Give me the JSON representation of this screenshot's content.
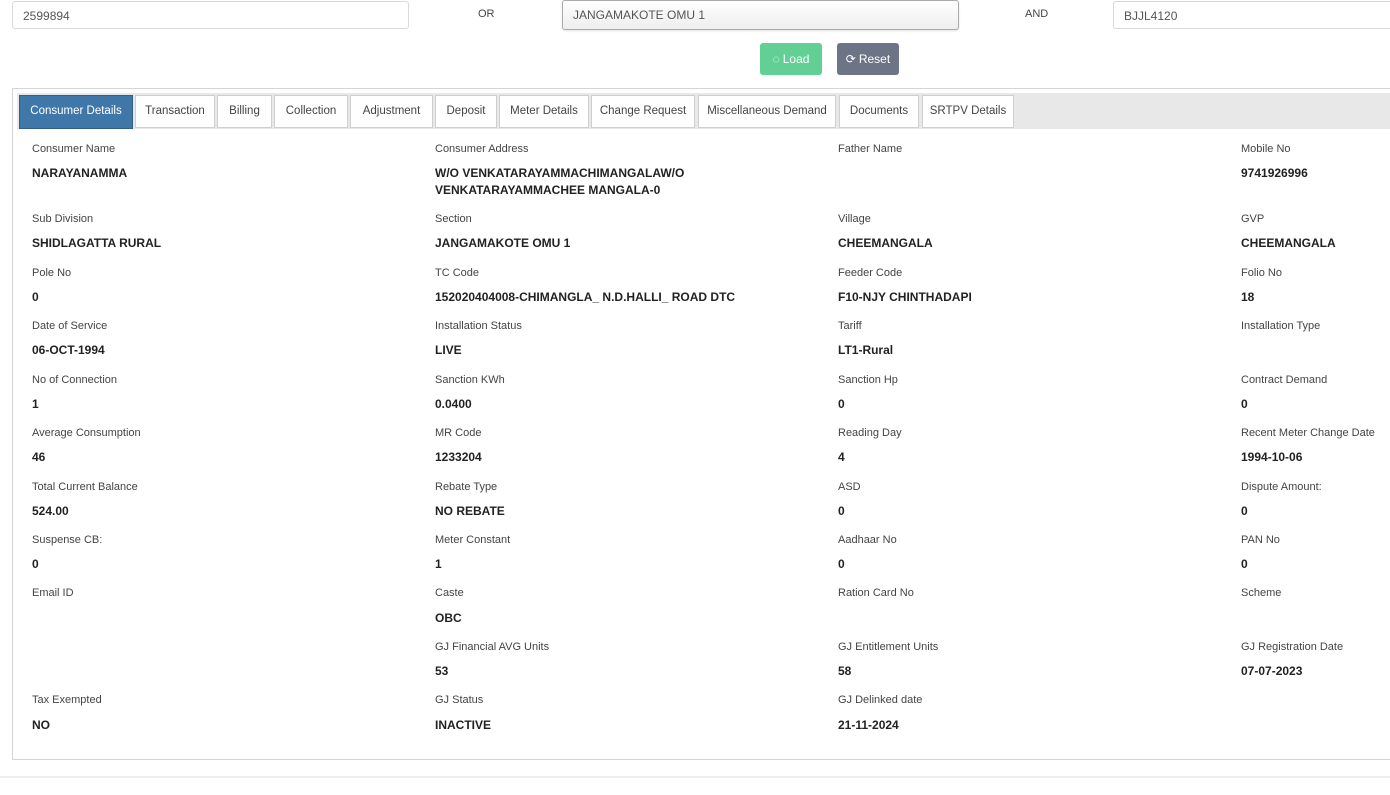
{
  "search": {
    "account_value": "2599894",
    "or_label": "OR",
    "section_value": "JANGAMAKOTE OMU 1",
    "and_label": "AND",
    "rr_value": "BJJL4120"
  },
  "buttons": {
    "load_label": "Load",
    "reset_label": "Reset"
  },
  "tabs": [
    {
      "label": "Consumer Details",
      "active": true
    },
    {
      "label": "Transaction"
    },
    {
      "label": "Billing"
    },
    {
      "label": "Collection"
    },
    {
      "label": "Adjustment"
    },
    {
      "label": "Deposit"
    },
    {
      "label": "Meter Details"
    },
    {
      "label": "Change Request"
    },
    {
      "label": "Miscellaneous Demand"
    },
    {
      "label": "Documents"
    },
    {
      "label": "SRTPV Details"
    }
  ],
  "fields": {
    "consumer_name": {
      "label": "Consumer Name",
      "value": "NARAYANAMMA"
    },
    "consumer_address": {
      "label": "Consumer Address",
      "value": "W/O VENKATARAYAMMACHIMANGALAW/O VENKATARAYAMMACHEE MANGALA-0"
    },
    "father_name": {
      "label": "Father Name",
      "value": ""
    },
    "mobile_no": {
      "label": "Mobile No",
      "value": "9741926996"
    },
    "sub_division": {
      "label": "Sub Division",
      "value": "SHIDLAGATTA RURAL"
    },
    "section": {
      "label": "Section",
      "value": "JANGAMAKOTE OMU 1"
    },
    "village": {
      "label": "Village",
      "value": "CHEEMANGALA"
    },
    "gvp": {
      "label": "GVP",
      "value": "CHEEMANGALA"
    },
    "pole_no": {
      "label": "Pole No",
      "value": "0"
    },
    "tc_code": {
      "label": "TC Code",
      "value": "152020404008-CHIMANGLA_ N.D.HALLI_ ROAD DTC"
    },
    "feeder_code": {
      "label": "Feeder Code",
      "value": "F10-NJY CHINTHADAPI"
    },
    "folio_no": {
      "label": "Folio No",
      "value": "18"
    },
    "date_of_service": {
      "label": "Date of Service",
      "value": "06-OCT-1994"
    },
    "installation_status": {
      "label": "Installation Status",
      "value": "LIVE"
    },
    "tariff": {
      "label": "Tariff",
      "value": "LT1-Rural"
    },
    "installation_type": {
      "label": "Installation Type",
      "value": ""
    },
    "no_of_connection": {
      "label": "No of Connection",
      "value": "1"
    },
    "sanction_kwh": {
      "label": "Sanction KWh",
      "value": "0.0400"
    },
    "sanction_hp": {
      "label": "Sanction Hp",
      "value": "0"
    },
    "contract_demand": {
      "label": "Contract Demand",
      "value": "0"
    },
    "average_consumption": {
      "label": "Average Consumption",
      "value": "46"
    },
    "mr_code": {
      "label": "MR Code",
      "value": "1233204"
    },
    "reading_day": {
      "label": "Reading Day",
      "value": "4"
    },
    "recent_meter_change_date": {
      "label": "Recent Meter Change Date",
      "value": "1994-10-06"
    },
    "total_current_balance": {
      "label": "Total Current Balance",
      "value": "524.00"
    },
    "rebate_type": {
      "label": "Rebate Type",
      "value": "NO REBATE"
    },
    "asd": {
      "label": "ASD",
      "value": "0"
    },
    "dispute_amount": {
      "label": "Dispute Amount:",
      "value": "0"
    },
    "suspense_cb": {
      "label": "Suspense CB:",
      "value": "0"
    },
    "meter_constant": {
      "label": "Meter Constant",
      "value": "1"
    },
    "aadhaar_no": {
      "label": "Aadhaar No",
      "value": "0"
    },
    "pan_no": {
      "label": "PAN No",
      "value": "0"
    },
    "email_id": {
      "label": "Email ID",
      "value": ""
    },
    "caste": {
      "label": "Caste",
      "value": "OBC"
    },
    "ration_card_no": {
      "label": "Ration Card No",
      "value": ""
    },
    "scheme": {
      "label": "Scheme",
      "value": ""
    },
    "gj_financial_avg_units": {
      "label": "GJ Financial AVG Units",
      "value": "53"
    },
    "gj_entitlement_units": {
      "label": "GJ Entitlement Units",
      "value": "58"
    },
    "gj_registration_date": {
      "label": "GJ Registration Date",
      "value": "07-07-2023"
    },
    "tax_exempted": {
      "label": "Tax Exempted",
      "value": "NO"
    },
    "gj_status": {
      "label": "GJ Status",
      "value": "INACTIVE"
    },
    "gj_delinked_date": {
      "label": "GJ Delinked date",
      "value": "21-11-2024"
    }
  }
}
